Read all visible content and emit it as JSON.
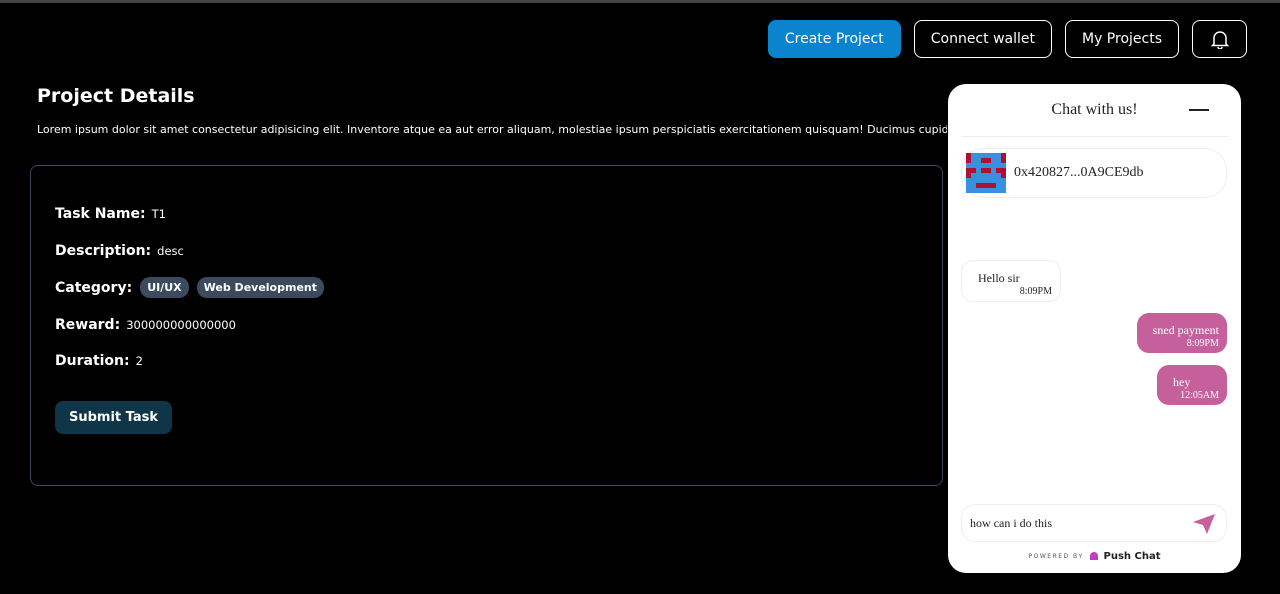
{
  "nav": {
    "create": "Create Project",
    "connect": "Connect wallet",
    "my_projects": "My Projects",
    "bell_icon": "bell-icon"
  },
  "page": {
    "title": "Project Details",
    "description": "Lorem ipsum dolor sit amet consectetur adipisicing elit. Inventore atque ea aut error aliquam, molestiae ipsum perspiciatis exercitationem quisquam! Ducimus cupiditate dolore voluptatum"
  },
  "task": {
    "name_label": "Task Name:",
    "name": "T1",
    "description_label": "Description:",
    "description": "desc",
    "category_label": "Category:",
    "categories": [
      "UI/UX",
      "Web Development"
    ],
    "reward_label": "Reward:",
    "reward": "300000000000000",
    "duration_label": "Duration:",
    "duration": "2",
    "submit": "Submit Task"
  },
  "chat": {
    "title": "Chat with us!",
    "peer": "0x420827...0A9CE9db",
    "messages": [
      {
        "text": "Hello sir",
        "time": "8:09PM",
        "from": "peer"
      },
      {
        "text": "sned payment",
        "time": "8:09PM",
        "from": "me"
      },
      {
        "text": "hey",
        "time": "12:05AM",
        "from": "me"
      }
    ],
    "input": "how can i do this",
    "powered_by": "POWERED BY",
    "brand": "Push Chat",
    "accent": "#c6609c"
  },
  "colors": {
    "primary": "#0b84d0",
    "submit": "#0f3548",
    "tag": "#3c4a5e"
  }
}
